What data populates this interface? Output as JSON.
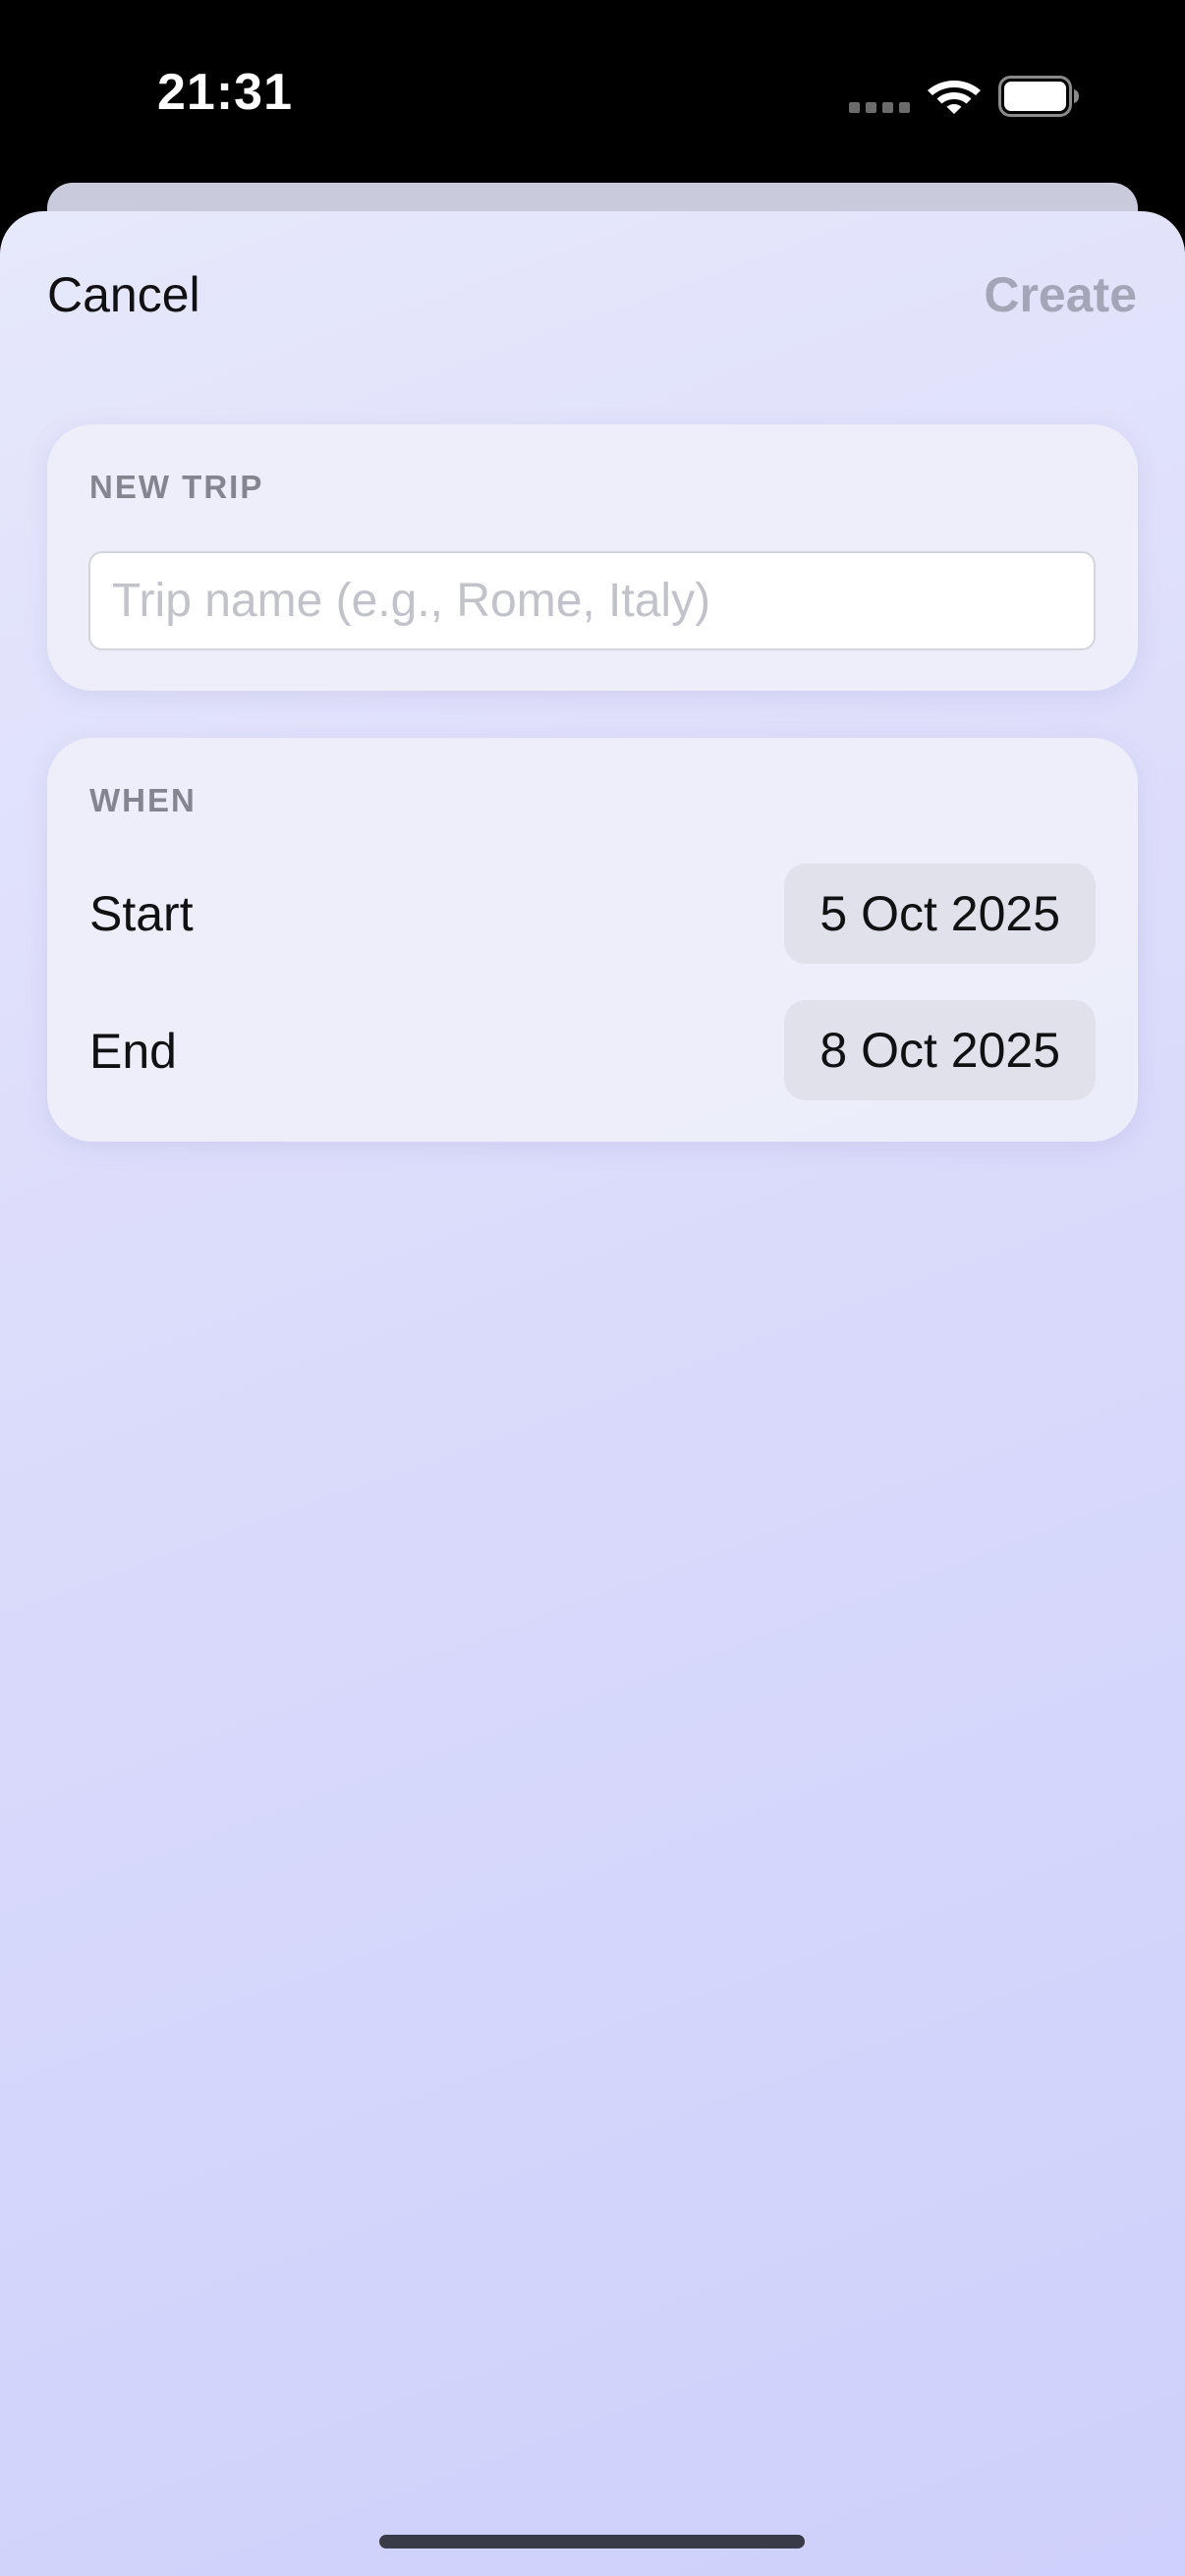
{
  "status_bar": {
    "time": "21:31",
    "icons": [
      "signal-icon",
      "wifi-icon",
      "battery-icon"
    ]
  },
  "nav": {
    "cancel_label": "Cancel",
    "create_label": "Create"
  },
  "new_trip": {
    "section_title": "NEW TRIP",
    "name_value": "",
    "name_placeholder": "Trip name (e.g., Rome, Italy)"
  },
  "when": {
    "section_title": "WHEN",
    "start_label": "Start",
    "start_date": "5 Oct 2025",
    "end_label": "End",
    "end_date": "8 Oct 2025"
  },
  "colors": {
    "accent_disabled": "#a4a6b8",
    "background_gradient_start": "#e6e8fb",
    "background_gradient_end": "#cfd0fb"
  }
}
